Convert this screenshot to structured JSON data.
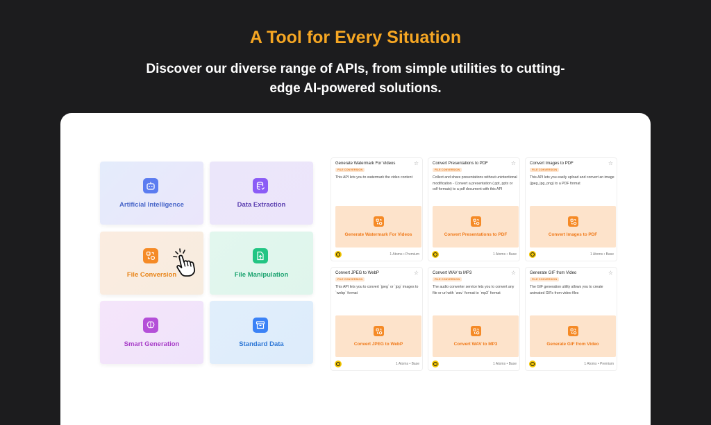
{
  "hero": {
    "title": "A Tool for Every Situation",
    "subtitle": "Discover our diverse range of APIs, from simple utilities to cutting-edge AI-powered solutions."
  },
  "categories": [
    {
      "label": "Artificial Intelligence",
      "icon": "robot-icon"
    },
    {
      "label": "Data Extraction",
      "icon": "database-icon"
    },
    {
      "label": "File Conversion",
      "icon": "convert-icon"
    },
    {
      "label": "File Manipulation",
      "icon": "file-edit-icon"
    },
    {
      "label": "Smart Generation",
      "icon": "brain-icon"
    },
    {
      "label": "Standard Data",
      "icon": "archive-icon"
    }
  ],
  "cards": [
    {
      "title": "Generate Watermark For Videos",
      "badge": "FILE CONVERSION",
      "desc": "This API lets you to watermark the video content",
      "thumb": "Generate Watermark For Videos",
      "meta": "1 Atoms • Premium"
    },
    {
      "title": "Convert Presentations to PDF",
      "badge": "FILE CONVERSION",
      "desc": "Collect and share presentations without unintentional modification - Convert a presentation ( ppt, pptx or odf formats) to a pdf document with this API",
      "thumb": "Convert Presentations to PDF",
      "meta": "1 Atoms • Base"
    },
    {
      "title": "Convert Images to PDF",
      "badge": "FILE CONVERSION",
      "desc": "This API lets you easily upload and convert an image (jpeg, jpg, png) to a PDF format",
      "thumb": "Convert Images to PDF",
      "meta": "1 Atoms • Base"
    },
    {
      "title": "Convert JPEG to WebP",
      "badge": "FILE CONVERSION",
      "desc": "This API lets you to convert `jpeg` or `jpg` images to `webp` format",
      "thumb": "Convert JPEG to WebP",
      "meta": "1 Atoms • Base"
    },
    {
      "title": "Convert WAV to MP3",
      "badge": "FILE CONVERSION",
      "desc": "The audio converter service lets you to convert any file or url with `wav` format to `mp3` format",
      "thumb": "Convert WAV to MP3",
      "meta": "1 Atoms • Base"
    },
    {
      "title": "Generate GIF from Video",
      "badge": "FILE CONVERSION",
      "desc": "The GIF generation utility allows you to create animated GIFs from video files",
      "thumb": "Generate GIF from Video",
      "meta": "1 Atoms • Premium"
    }
  ],
  "colors": {
    "background": "#1c1c1e",
    "title_accent": "#f5a623",
    "card_thumb": "#fde3cb",
    "card_accent": "#f58a26"
  }
}
